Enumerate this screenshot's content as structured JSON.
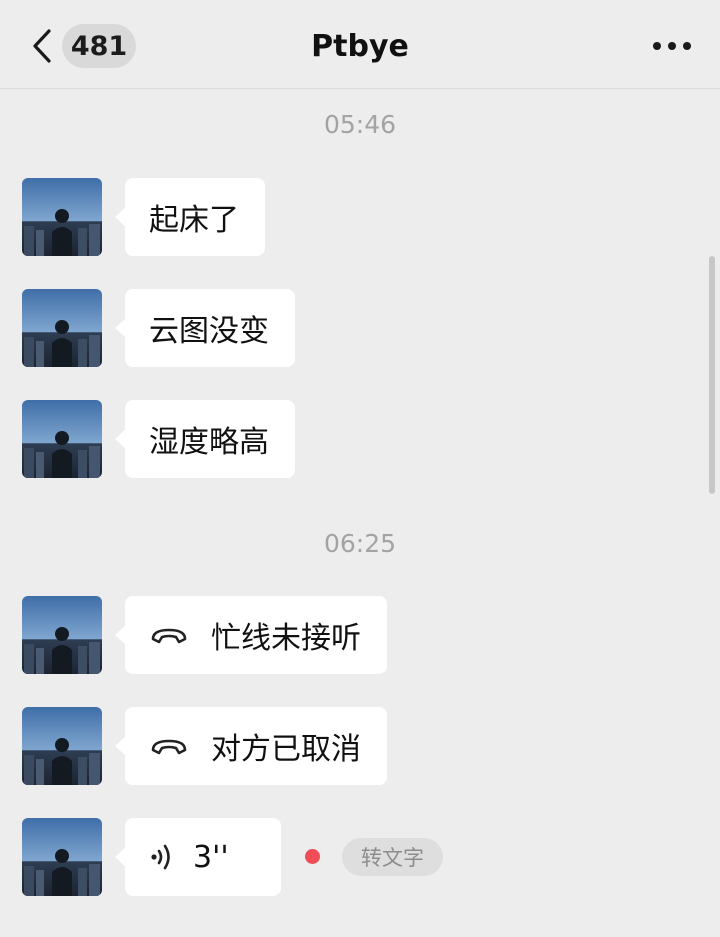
{
  "header": {
    "unread_count": "481",
    "title": "Ptbye"
  },
  "messages": [
    {
      "time": "05:46"
    },
    {
      "text": "起床了"
    },
    {
      "text": "云图没变"
    },
    {
      "text": "湿度略高"
    },
    {
      "time": "06:25"
    },
    {
      "text": "忙线未接听"
    },
    {
      "text": "对方已取消"
    },
    {
      "duration": "3''",
      "convert_label": "转文字"
    }
  ],
  "colors": {
    "background": "#ededed",
    "bubble": "#ffffff",
    "unread_dot": "#f04d57",
    "timestamp": "#a3a3a3"
  },
  "icons": [
    "back-chevron-icon",
    "more-dots-icon",
    "phone-hangup-icon",
    "voice-wave-icon"
  ]
}
